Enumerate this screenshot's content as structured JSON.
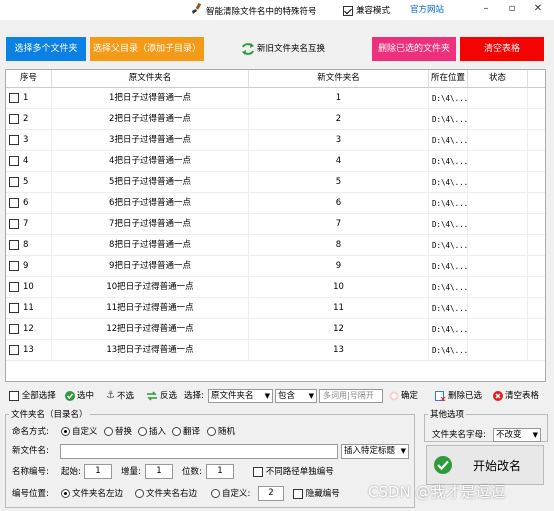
{
  "titlebar": {
    "title": "智能清除文件名中的特殊符号",
    "compat_label": "兼容模式",
    "compat_checked": true,
    "site_label": "官方网站"
  },
  "top_buttons": {
    "select_folders": "选择多个文件夹",
    "select_parent": "选择父目录（添加子目录）",
    "swap_names": "新旧文件夹名互换",
    "delete_selected": "删除已选的文件夹",
    "clear_table": "清空表格"
  },
  "table": {
    "headers": [
      "序号",
      "原文件夹名",
      "新文件夹名",
      "所在位置",
      "状态"
    ],
    "rows": [
      {
        "no": "1",
        "orig": "1把日子过得普通一点",
        "new": "1",
        "loc": "D:\\4\\...",
        "status": ""
      },
      {
        "no": "2",
        "orig": "2把日子过得普通一点",
        "new": "2",
        "loc": "D:\\4\\...",
        "status": ""
      },
      {
        "no": "3",
        "orig": "3把日子过得普通一点",
        "new": "3",
        "loc": "D:\\4\\...",
        "status": ""
      },
      {
        "no": "4",
        "orig": "4把日子过得普通一点",
        "new": "4",
        "loc": "D:\\4\\...",
        "status": ""
      },
      {
        "no": "5",
        "orig": "5把日子过得普通一点",
        "new": "5",
        "loc": "D:\\4\\...",
        "status": ""
      },
      {
        "no": "6",
        "orig": "6把日子过得普通一点",
        "new": "6",
        "loc": "D:\\4\\...",
        "status": ""
      },
      {
        "no": "7",
        "orig": "7把日子过得普通一点",
        "new": "7",
        "loc": "D:\\4\\...",
        "status": ""
      },
      {
        "no": "8",
        "orig": "8把日子过得普通一点",
        "new": "8",
        "loc": "D:\\4\\...",
        "status": ""
      },
      {
        "no": "9",
        "orig": "9把日子过得普通一点",
        "new": "9",
        "loc": "D:\\4\\...",
        "status": ""
      },
      {
        "no": "10",
        "orig": "10把日子过得普通一点",
        "new": "10",
        "loc": "D:\\4\\...",
        "status": ""
      },
      {
        "no": "11",
        "orig": "11把日子过得普通一点",
        "new": "11",
        "loc": "D:\\4\\...",
        "status": ""
      },
      {
        "no": "12",
        "orig": "12把日子过得普通一点",
        "new": "12",
        "loc": "D:\\4\\...",
        "status": ""
      },
      {
        "no": "13",
        "orig": "13把日子过得普通一点",
        "new": "13",
        "loc": "D:\\4\\...",
        "status": ""
      }
    ]
  },
  "toolbar": {
    "select_all": "全部选择",
    "check": "选中",
    "uncheck": "不选",
    "invert": "反选",
    "select_label": "选择:",
    "field_value": "原文件夹名",
    "match_value": "包含",
    "filter_placeholder": "多词用|号隔开",
    "confirm": "确定",
    "delete_selected": "删除已选",
    "clear_table": "清空表格"
  },
  "rename_group": {
    "title": "文件夹名（目录名）",
    "method_label": "命名方式:",
    "methods": [
      "自定义",
      "替换",
      "插入",
      "翻译",
      "随机"
    ],
    "new_name_label": "新文件名:",
    "new_name_value": "",
    "insert_title": "插入特定标题",
    "numbering_label": "名称编号:",
    "start_label": "起始:",
    "start_value": "1",
    "step_label": "增量:",
    "step_value": "1",
    "digits_label": "位数:",
    "digits_value": "1",
    "separate_label": "不同路径单独编号",
    "position_label": "编号位置:",
    "positions": [
      "文件夹名左边",
      "文件夹名右边",
      "自定义:"
    ],
    "custom_pos_value": "2",
    "hide_numbering": "隐藏编号"
  },
  "other_group": {
    "title": "其他选项",
    "case_label": "文件夹名字母:",
    "case_value": "不改变"
  },
  "start_button": {
    "label": "开始改名"
  },
  "watermark": "CSDN @我才是逗逗"
}
